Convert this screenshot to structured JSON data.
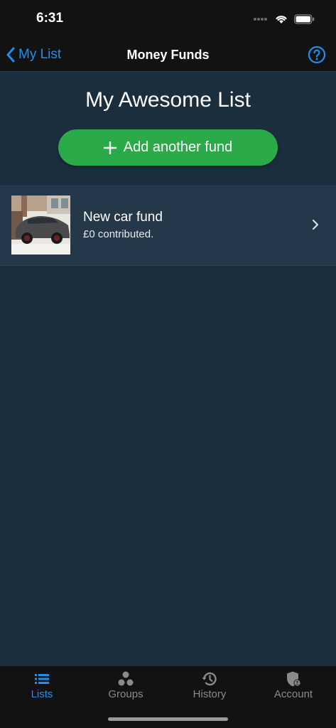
{
  "status_bar": {
    "time": "6:31"
  },
  "nav": {
    "back_label": "My List",
    "title": "Money Funds",
    "help_icon": "question-circle-icon"
  },
  "list": {
    "title": "My Awesome List",
    "add_button_label": "Add another fund"
  },
  "funds": [
    {
      "name": "New car fund",
      "contributed": "£0 contributed."
    }
  ],
  "tabs": [
    {
      "label": "Lists",
      "icon": "list-icon",
      "active": true
    },
    {
      "label": "Groups",
      "icon": "groups-icon",
      "active": false
    },
    {
      "label": "History",
      "icon": "history-icon",
      "active": false
    },
    {
      "label": "Account",
      "icon": "account-shield-icon",
      "active": false
    }
  ],
  "colors": {
    "accent": "#1f8ef1",
    "add_button": "#2aaa48",
    "background": "#1b2e3e",
    "bars": "#121212"
  }
}
